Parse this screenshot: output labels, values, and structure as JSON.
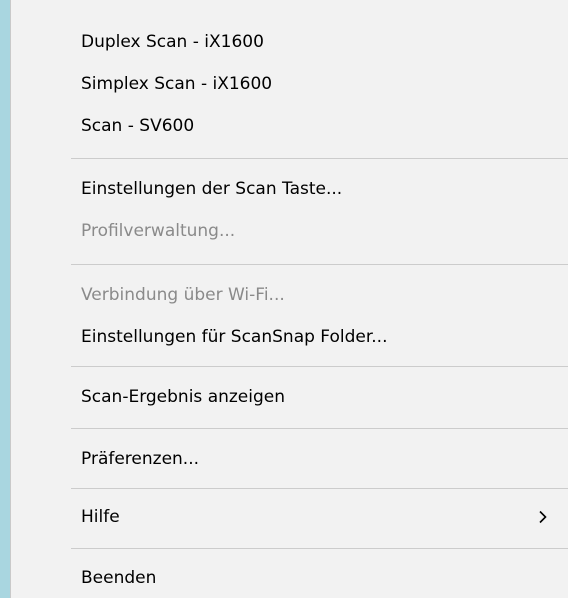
{
  "context_menu": {
    "items": [
      {
        "label": "Duplex Scan - iX1600",
        "enabled": true
      },
      {
        "label": "Simplex Scan - iX1600",
        "enabled": true
      },
      {
        "label": "Scan - SV600",
        "enabled": true
      },
      {
        "label": "Einstellungen der Scan Taste...",
        "enabled": true
      },
      {
        "label": "Profilverwaltung...",
        "enabled": false
      },
      {
        "label": "Verbindung über Wi-Fi...",
        "enabled": false
      },
      {
        "label": "Einstellungen für ScanSnap Folder...",
        "enabled": true
      },
      {
        "label": "Scan-Ergebnis anzeigen",
        "enabled": true
      },
      {
        "label": "Präferenzen...",
        "enabled": true
      },
      {
        "label": "Hilfe",
        "enabled": true,
        "submenu": true,
        "icon": "chevron-right-icon"
      },
      {
        "label": "Beenden",
        "enabled": true
      }
    ]
  },
  "colors": {
    "desktop_background": "#a9d6e0",
    "menu_background": "#f2f2f2",
    "enabled_text": "#000000",
    "disabled_text": "#8a8a8a",
    "separator": "#cccccc"
  }
}
